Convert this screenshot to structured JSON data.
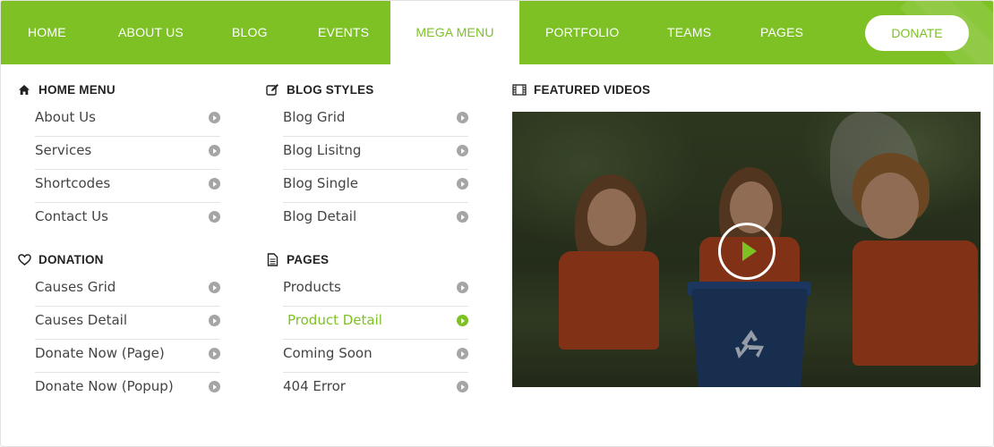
{
  "colors": {
    "accent": "#7dc125",
    "nav_text": "#ffffff",
    "text": "#444444",
    "heading": "#222222"
  },
  "nav": {
    "items": [
      "HOME",
      "ABOUT US",
      "BLOG",
      "EVENTS",
      "MEGA MENU",
      "PORTFOLIO",
      "TEAMS",
      "PAGES"
    ],
    "active": "MEGA MENU",
    "donate_label": "DONATE"
  },
  "mega": {
    "home_menu": {
      "title": "HOME MENU",
      "icon": "home-icon",
      "items": [
        "About Us",
        "Services",
        "Shortcodes",
        "Contact Us"
      ]
    },
    "donation": {
      "title": "DONATION",
      "icon": "heart-icon",
      "items": [
        "Causes Grid",
        "Causes Detail",
        "Donate Now (Page)",
        "Donate Now (Popup)"
      ]
    },
    "blog_styles": {
      "title": "BLOG STYLES",
      "icon": "edit-icon",
      "items": [
        "Blog Grid",
        "Blog Lisitng",
        "Blog Single",
        "Blog Detail"
      ]
    },
    "pages": {
      "title": "PAGES",
      "icon": "document-icon",
      "items": [
        "Products",
        "Product Detail",
        "Coming Soon",
        "404 Error"
      ],
      "active": "Product Detail"
    },
    "featured_videos": {
      "title": "FEATURED VIDEOS",
      "icon": "film-icon"
    }
  }
}
